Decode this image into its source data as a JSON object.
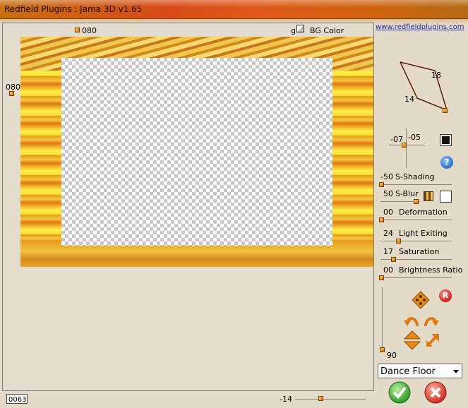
{
  "window": {
    "title": "Redfield Plugins : Jama 3D  v1.65"
  },
  "preview": {
    "top_offset": "080",
    "left_offset": "080",
    "bg_color_letter": "g",
    "bg_color_label": "BG Color",
    "link": "www.redfieldplugins.com",
    "zoom_value": "0063",
    "bottom_slider_value": "-14"
  },
  "controls": {
    "light_labels": [
      "18",
      "14"
    ],
    "position": {
      "x": "-07",
      "y": "-05"
    },
    "sliders": [
      {
        "value": "-50",
        "label": "S-Shading"
      },
      {
        "value": "50",
        "label": "S-Blur"
      },
      {
        "value": "00",
        "label": "Deformation"
      },
      {
        "value": "24",
        "label": "Light Exiting"
      },
      {
        "value": "17",
        "label": "Saturation"
      },
      {
        "value": "00",
        "label": "Brightness Ratio"
      }
    ],
    "vertical_value": "90",
    "dropdown_value": "Dance Floor",
    "help_glyph": "?",
    "reset_glyph": "R"
  },
  "colors": {
    "accent": "#e07a10",
    "ok": "#34a82a",
    "cancel": "#d8302a",
    "help": "#2a70c8"
  }
}
